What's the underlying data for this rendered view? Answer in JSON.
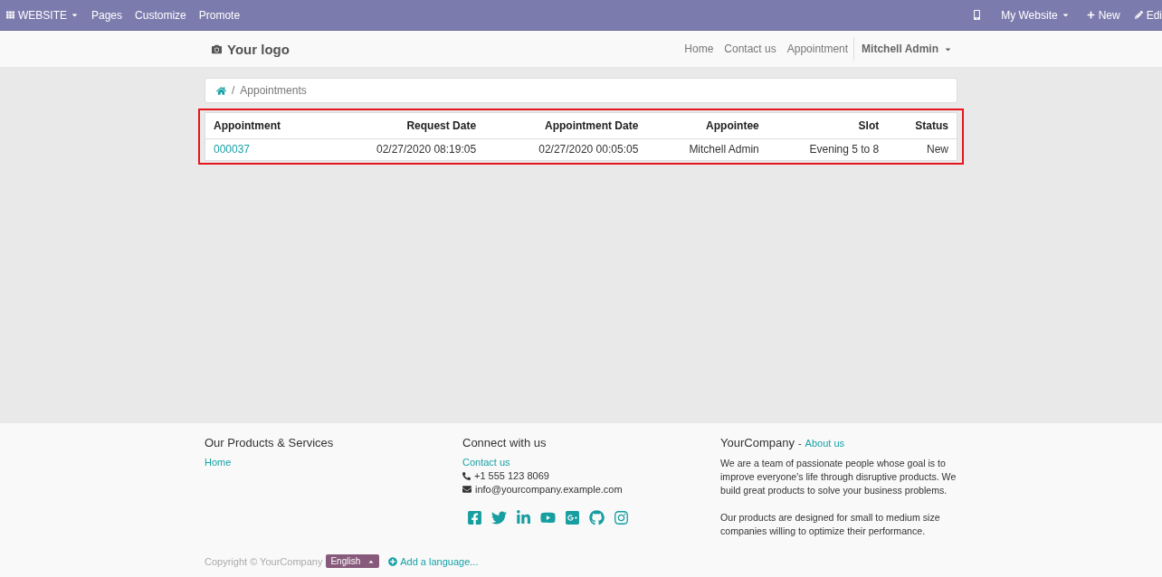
{
  "admin_bar": {
    "app_menu": "WEBSITE",
    "menu_items": [
      "Pages",
      "Customize",
      "Promote"
    ],
    "website_menu": "My Website",
    "new_button": "New",
    "edit_button": "Edi"
  },
  "header": {
    "logo": "Your logo",
    "nav": [
      {
        "label": "Home",
        "selected": false
      },
      {
        "label": "Contact us",
        "selected": false
      },
      {
        "label": "Appointment",
        "selected": false
      }
    ],
    "user": "Mitchell Admin"
  },
  "breadcrumb": {
    "separator": "/",
    "current": "Appointments"
  },
  "table": {
    "columns": [
      "Appointment",
      "Request Date",
      "Appointment Date",
      "Appointee",
      "Slot",
      "Status"
    ],
    "rows": [
      [
        "000037",
        "02/27/2020 08:19:05",
        "02/27/2020 00:05:05",
        "Mitchell Admin",
        "Evening 5 to 8",
        "New"
      ]
    ]
  },
  "footer": {
    "products": {
      "title": "Our Products & Services",
      "links": [
        "Home"
      ]
    },
    "connect": {
      "title": "Connect with us",
      "contact_link": "Contact us",
      "phone": "+1 555 123 8069",
      "email": "info@yourcompany.example.com"
    },
    "about": {
      "title": "YourCompany",
      "separator": "-",
      "link": "About us",
      "paragraphs": [
        "We are a team of passionate people whose goal is to improve everyone's life through disruptive products. We build great products to solve your business problems.",
        "Our products are designed for small to medium size companies willing to optimize their performance."
      ]
    },
    "copyright": "Copyright © YourCompany",
    "language": "English",
    "add_language": "Add a language..."
  }
}
